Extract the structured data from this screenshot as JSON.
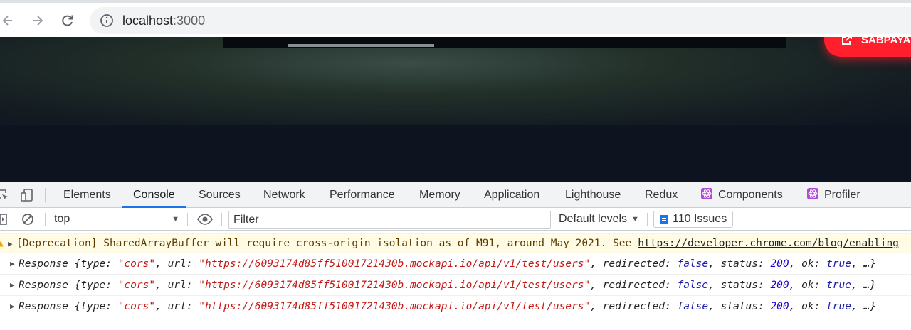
{
  "browser": {
    "url_host": "localhost",
    "url_port": ":3000"
  },
  "page": {
    "cta_label": "SABPAYA"
  },
  "devtools": {
    "tabs": [
      {
        "label": "Elements"
      },
      {
        "label": "Console",
        "active": true
      },
      {
        "label": "Sources"
      },
      {
        "label": "Network"
      },
      {
        "label": "Performance"
      },
      {
        "label": "Memory"
      },
      {
        "label": "Application"
      },
      {
        "label": "Lighthouse"
      },
      {
        "label": "Redux"
      },
      {
        "label": "Components"
      },
      {
        "label": "Profiler"
      }
    ],
    "context": "top",
    "filter_placeholder": "Filter",
    "levels_label": "Default levels",
    "issues_label": "110 Issues"
  },
  "console": {
    "warning": {
      "text": "[Deprecation] SharedArrayBuffer will require cross-origin isolation as of M91, around May 2021. See",
      "link": "https://developer.chrome.com/blog/enabling"
    },
    "logs": [
      {
        "prefix": "Response",
        "type_key": "type",
        "type_val": "\"cors\"",
        "url_key": "url",
        "url_val": "\"https://6093174d85ff51001721430b.mockapi.io/api/v1/test/users\"",
        "redir_key": "redirected",
        "redir_val": "false",
        "status_key": "status",
        "status_val": "200",
        "ok_key": "ok",
        "ok_val": "true",
        "more": "…}"
      },
      {
        "prefix": "Response",
        "type_key": "type",
        "type_val": "\"cors\"",
        "url_key": "url",
        "url_val": "\"https://6093174d85ff51001721430b.mockapi.io/api/v1/test/users\"",
        "redir_key": "redirected",
        "redir_val": "false",
        "status_key": "status",
        "status_val": "200",
        "ok_key": "ok",
        "ok_val": "true",
        "more": "…}"
      },
      {
        "prefix": "Response",
        "type_key": "type",
        "type_val": "\"cors\"",
        "url_key": "url",
        "url_val": "\"https://6093174d85ff51001721430b.mockapi.io/api/v1/test/users\"",
        "redir_key": "redirected",
        "redir_val": "false",
        "status_key": "status",
        "status_val": "200",
        "ok_key": "ok",
        "ok_val": "true",
        "more": "…}"
      }
    ]
  },
  "colors": {
    "accent": "#1a73e8",
    "cta": "#ff1f2d",
    "string": "#c41a16",
    "keyword": "#1a1aa6",
    "warning_bg": "#fffbe5"
  }
}
